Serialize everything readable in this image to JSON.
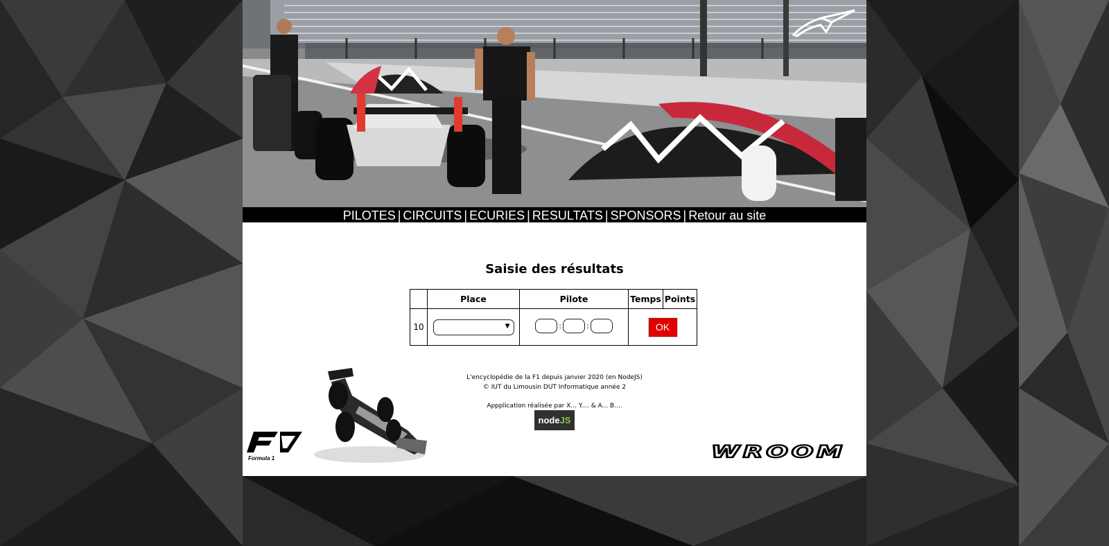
{
  "nav": {
    "items": [
      {
        "label": "PILOTES"
      },
      {
        "label": "CIRCUITS"
      },
      {
        "label": "ECURIES"
      },
      {
        "label": "RESULTATS"
      },
      {
        "label": "SPONSORS"
      },
      {
        "label": "Retour au site"
      }
    ],
    "separator": "|"
  },
  "main": {
    "title": "Saisie des résultats",
    "table": {
      "headers": [
        "",
        "Place",
        "Pilote",
        "Temps",
        "Points"
      ],
      "row": {
        "number": "10",
        "place_value": "",
        "time_separator": ":",
        "submit_label": "OK"
      }
    }
  },
  "footer": {
    "line1": "L'encyclopédie de la F1 depuis janvier 2020 (en NodeJS)",
    "line2": "© IUT du Limousin DUT Informatique année 2",
    "line3": "Appplication réalisée par X... Y.... & A... B....",
    "nodejs_badge": {
      "text_node": "node",
      "text_js": "JS"
    },
    "f1_logo_text": "Formula 1",
    "wroom_logo_text": "WROOM"
  },
  "colors": {
    "nav_background": "#000000",
    "ok_button": "#e00000",
    "page_background": "#ffffff",
    "nodejs_accent": "#8cc84b"
  },
  "icons": {
    "banner_logo": "alpinestars-star-icon",
    "select_arrow": "triangle-down-icon"
  }
}
